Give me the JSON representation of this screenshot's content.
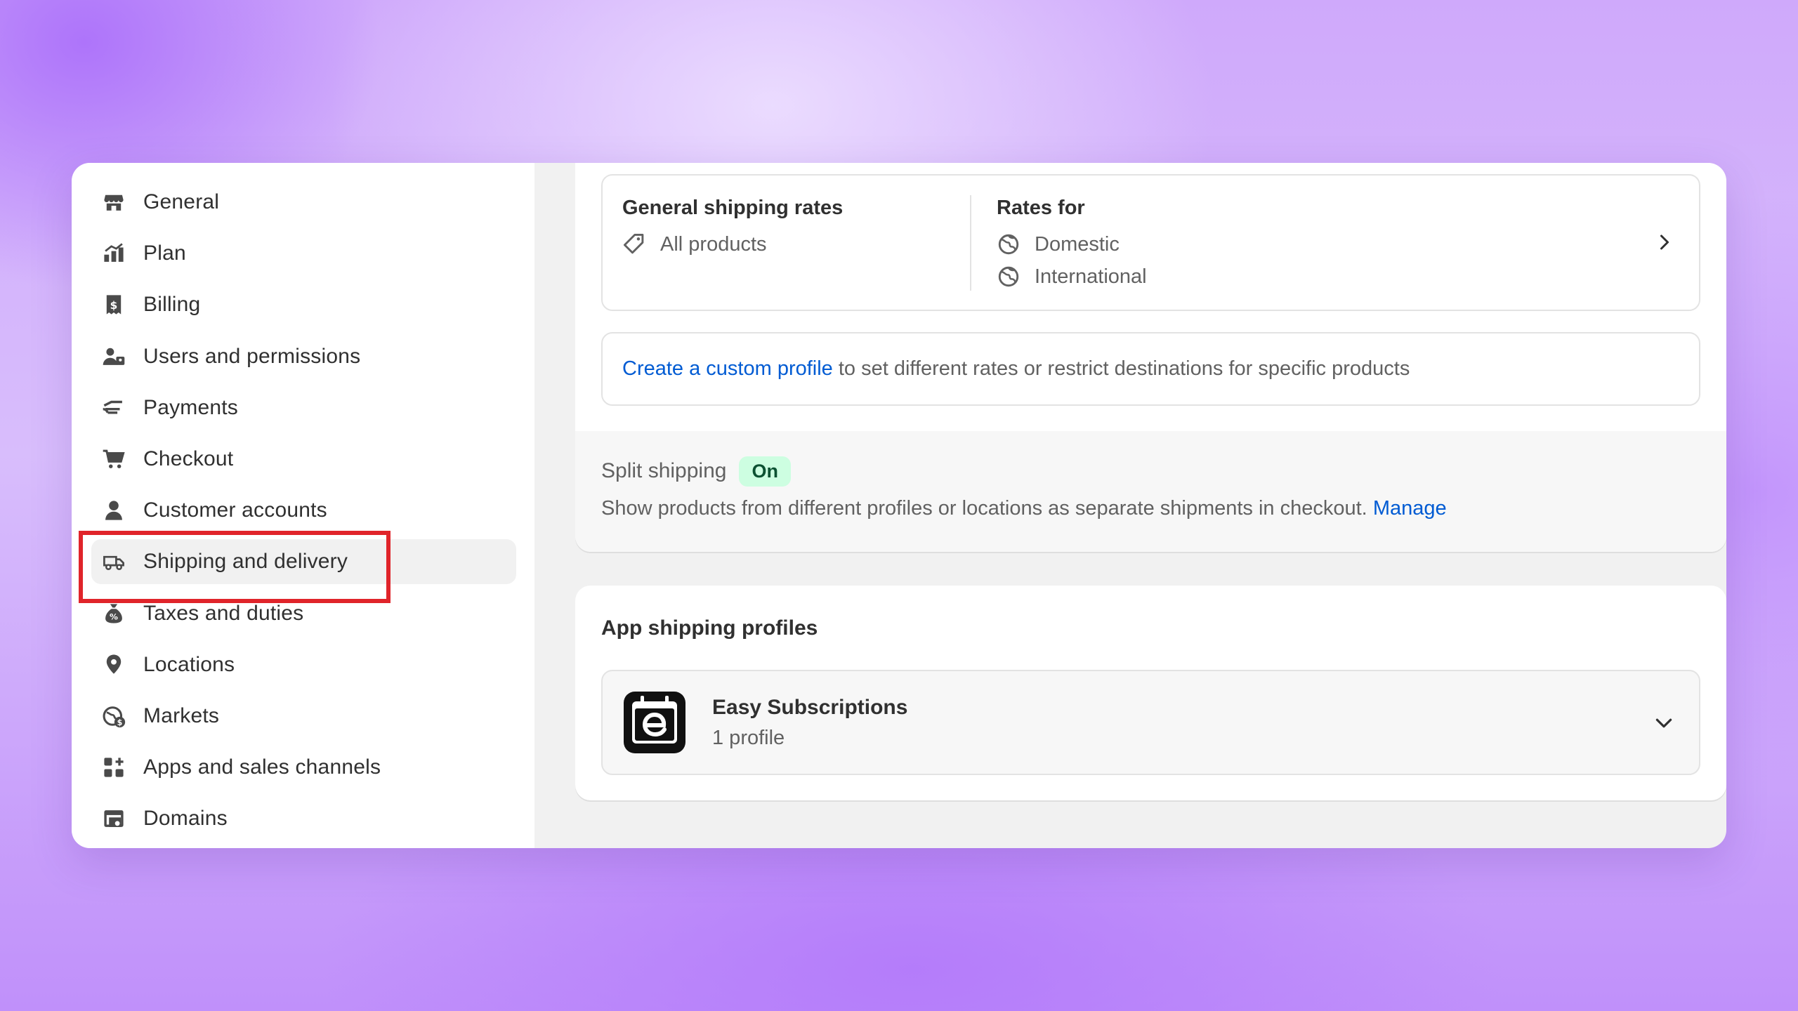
{
  "sidebar": {
    "items": [
      {
        "label": "General",
        "icon": "store-icon"
      },
      {
        "label": "Plan",
        "icon": "plan-icon"
      },
      {
        "label": "Billing",
        "icon": "billing-icon"
      },
      {
        "label": "Users and permissions",
        "icon": "users-icon"
      },
      {
        "label": "Payments",
        "icon": "payments-icon"
      },
      {
        "label": "Checkout",
        "icon": "cart-icon"
      },
      {
        "label": "Customer accounts",
        "icon": "person-icon"
      },
      {
        "label": "Shipping and delivery",
        "icon": "truck-icon",
        "active": true
      },
      {
        "label": "Taxes and duties",
        "icon": "tax-bag-icon"
      },
      {
        "label": "Locations",
        "icon": "location-pin-icon"
      },
      {
        "label": "Markets",
        "icon": "globe-dollar-icon"
      },
      {
        "label": "Apps and sales channels",
        "icon": "apps-icon"
      },
      {
        "label": "Domains",
        "icon": "domains-icon"
      }
    ]
  },
  "shipping": {
    "general_rates": {
      "heading": "General shipping rates",
      "products": "All products"
    },
    "rates_for": {
      "heading": "Rates for",
      "regions": [
        "Domestic",
        "International"
      ]
    },
    "custom_profile": {
      "link_text": "Create a custom profile",
      "rest_text": " to set different rates or restrict destinations for specific products"
    },
    "split_shipping": {
      "title": "Split shipping",
      "badge": "On",
      "description": "Show products from different profiles or locations as separate shipments in checkout. ",
      "manage_link": "Manage"
    }
  },
  "app_profiles": {
    "title": "App shipping profiles",
    "apps": [
      {
        "name": "Easy Subscriptions",
        "subtitle": "1 profile",
        "icon": "easy-subscriptions-logo"
      }
    ]
  },
  "colors": {
    "link": "#005bd3",
    "badge_bg": "#cdfee1",
    "badge_text": "#0c5132",
    "highlight": "#e0242a"
  }
}
